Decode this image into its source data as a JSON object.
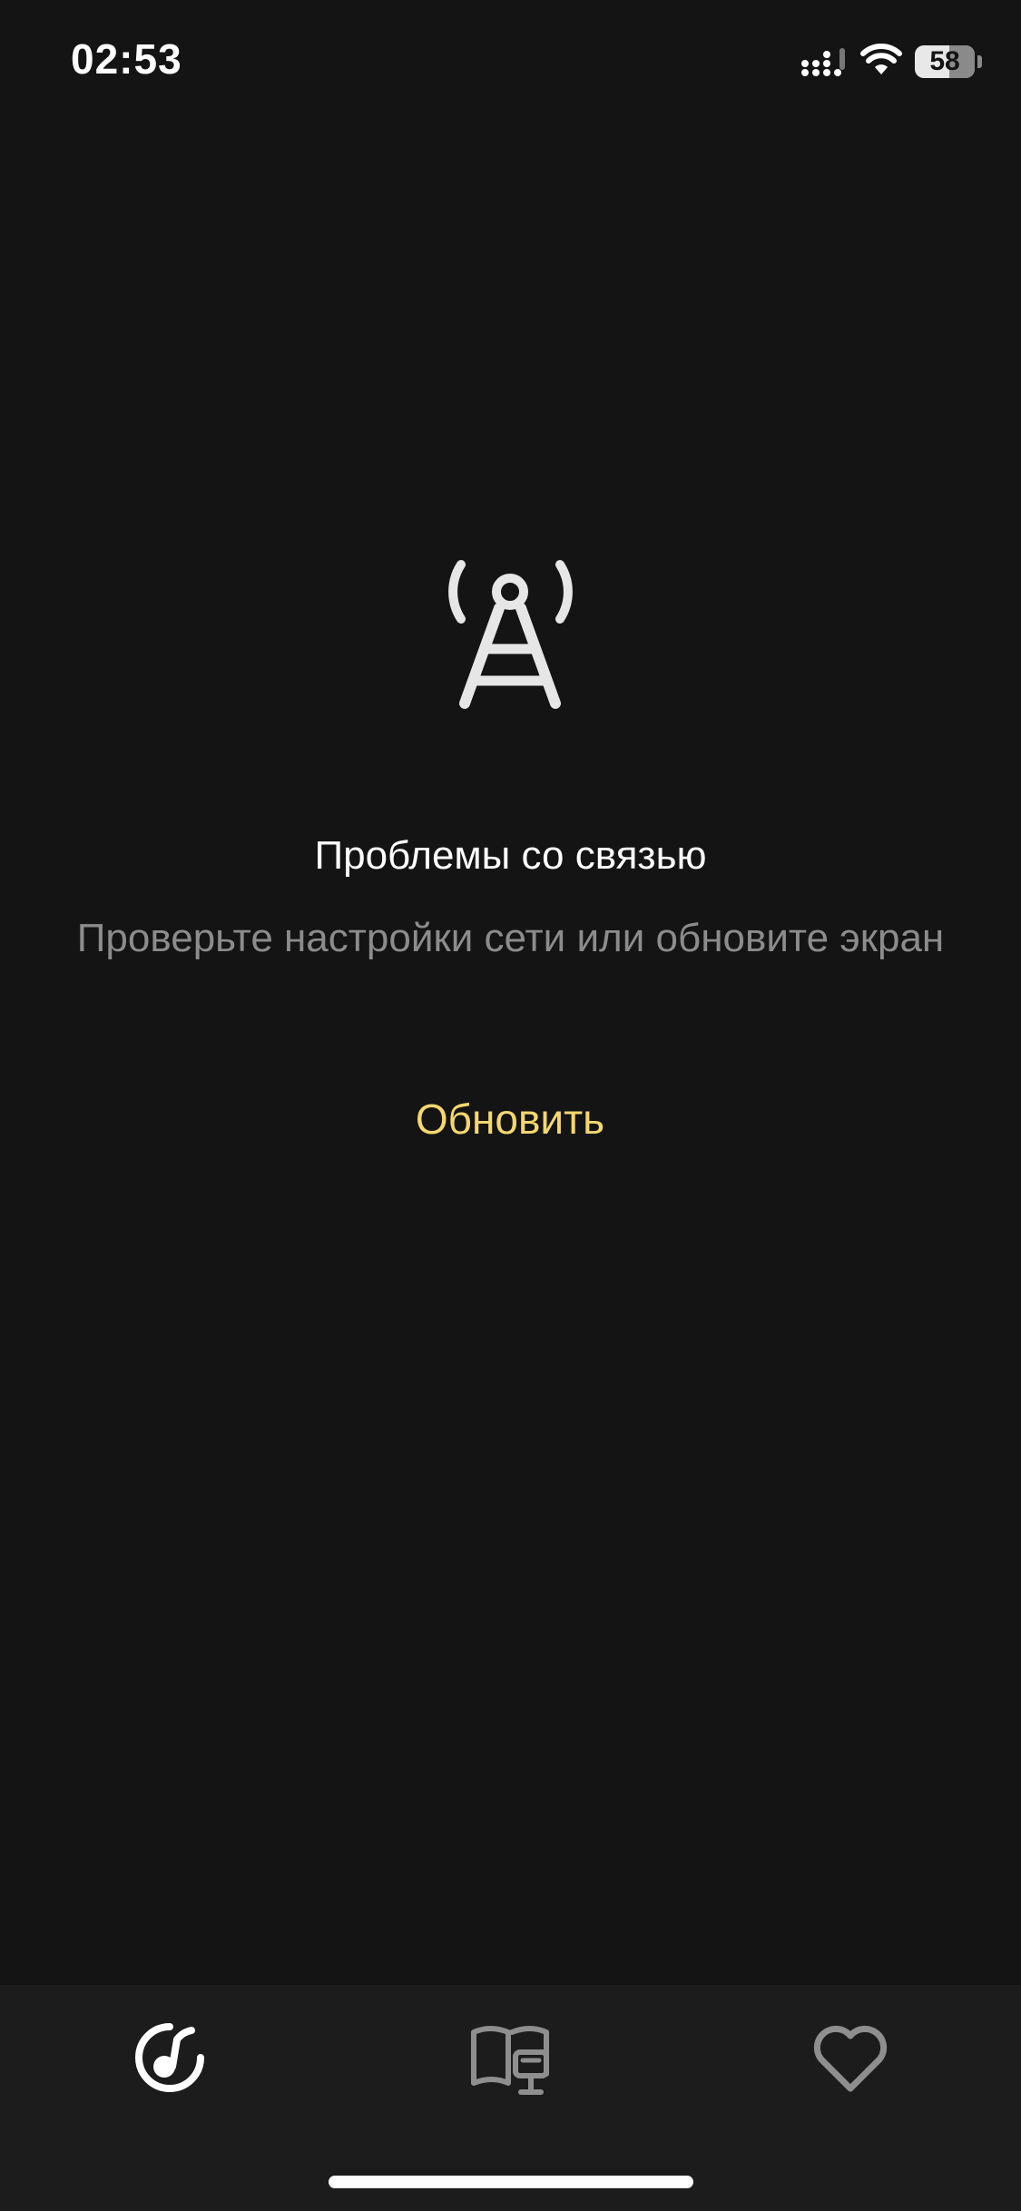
{
  "status_bar": {
    "time": "02:53",
    "battery_level": "58",
    "icons": [
      "signal-icon",
      "wifi-icon",
      "battery-icon"
    ]
  },
  "error": {
    "icon": "cell-tower-icon",
    "title": "Проблемы со связью",
    "subtitle": "Проверьте настройки сети или обновите экран",
    "refresh_label": "Обновить"
  },
  "tab_bar": {
    "tabs": [
      {
        "icon": "music-icon",
        "active": true
      },
      {
        "icon": "book-icon",
        "active": false
      },
      {
        "icon": "heart-icon",
        "active": false
      }
    ]
  },
  "colors": {
    "background": "#141414",
    "tab_bar_background": "#1c1c1c",
    "accent": "#f5d76e",
    "secondary_text": "#8c8c8c",
    "inactive_icon": "#8e8e8e"
  }
}
